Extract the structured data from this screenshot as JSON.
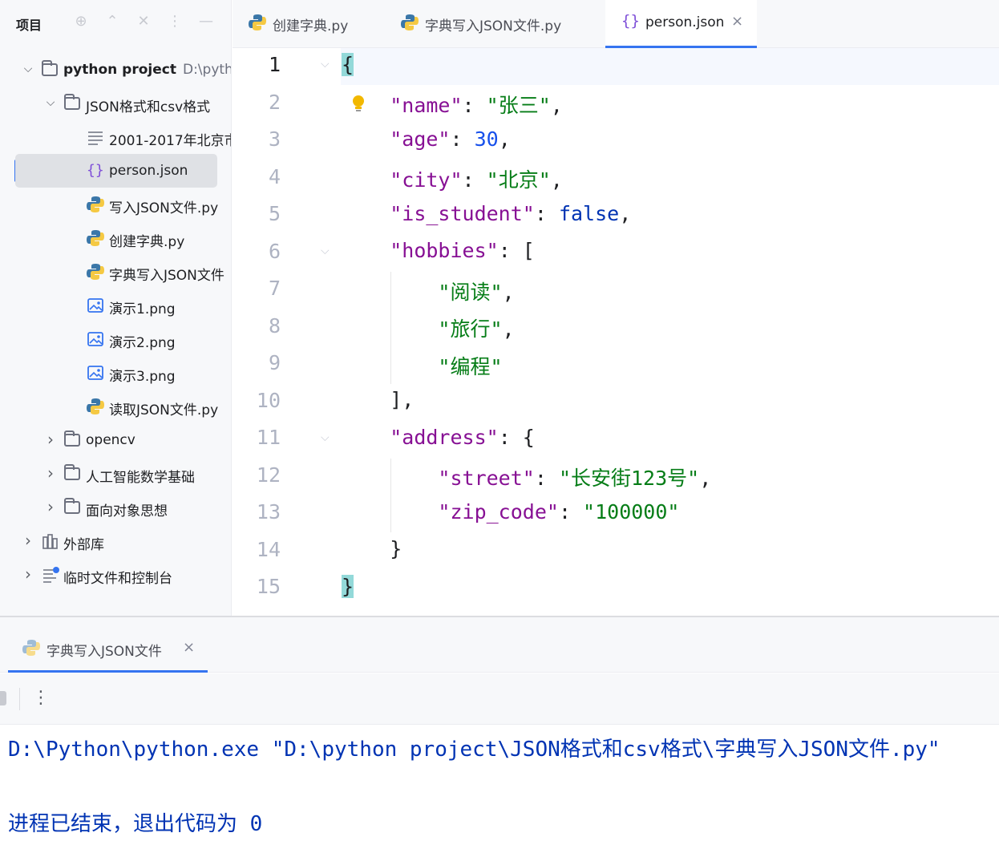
{
  "project": {
    "title": "项目",
    "tree": [
      {
        "label": "python project",
        "path": "D:\\pythor",
        "icon": "folder-icon",
        "expanded": true,
        "depth": 0,
        "bold": true
      },
      {
        "label": "JSON格式和csv格式",
        "icon": "folder-icon",
        "expanded": true,
        "depth": 1
      },
      {
        "label": "2001-2017年北京市",
        "icon": "text-file-icon",
        "depth": 2
      },
      {
        "label": "person.json",
        "icon": "json-file-icon",
        "depth": 2,
        "selected": true
      },
      {
        "label": "写入JSON文件.py",
        "icon": "python-file-icon",
        "depth": 2
      },
      {
        "label": "创建字典.py",
        "icon": "python-file-icon",
        "depth": 2
      },
      {
        "label": "字典写入JSON文件",
        "icon": "python-file-icon",
        "depth": 2
      },
      {
        "label": "演示1.png",
        "icon": "image-file-icon",
        "depth": 2
      },
      {
        "label": "演示2.png",
        "icon": "image-file-icon",
        "depth": 2
      },
      {
        "label": "演示3.png",
        "icon": "image-file-icon",
        "depth": 2
      },
      {
        "label": "读取JSON文件.py",
        "icon": "python-file-icon",
        "depth": 2
      },
      {
        "label": "opencv",
        "icon": "folder-icon",
        "expanded": false,
        "depth": 1
      },
      {
        "label": "人工智能数学基础",
        "icon": "folder-icon",
        "expanded": false,
        "depth": 1
      },
      {
        "label": "面向对象思想",
        "icon": "folder-icon",
        "expanded": false,
        "depth": 1
      },
      {
        "label": "外部库",
        "icon": "library-icon",
        "expanded": false,
        "depth": 0
      },
      {
        "label": "临时文件和控制台",
        "icon": "scratches-icon",
        "expanded": false,
        "depth": 0
      }
    ]
  },
  "tabs": [
    {
      "label": "创建字典.py",
      "icon": "python-file-icon",
      "active": false
    },
    {
      "label": "字典写入JSON文件.py",
      "icon": "python-file-icon",
      "active": false
    },
    {
      "label": "person.json",
      "icon": "json-file-icon",
      "active": true,
      "close": "×"
    }
  ],
  "editor": {
    "line_numbers": [
      "1",
      "2",
      "3",
      "4",
      "5",
      "6",
      "7",
      "8",
      "9",
      "10",
      "11",
      "12",
      "13",
      "14",
      "15"
    ],
    "current_line": 1
  },
  "run": {
    "tab_label": "字典写入JSON文件",
    "tab_close": "×",
    "toolbar_more": "⋮",
    "output": [
      "D:\\Python\\python.exe \"D:\\python project\\JSON格式和csv格式\\字典写入JSON文件.py\"",
      "",
      "进程已结束，退出代码为 0"
    ]
  },
  "colors": {
    "accent": "#3574f0",
    "json_key": "#871094",
    "json_string": "#067d17",
    "json_number": "#1750eb",
    "json_keyword": "#0033b3",
    "brace_match": "#93d9d9"
  }
}
